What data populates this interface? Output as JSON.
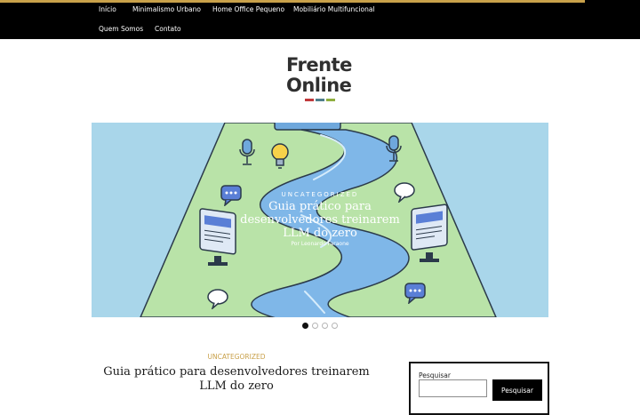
{
  "nav": {
    "items": [
      {
        "label": "Início"
      },
      {
        "label": "Minimalismo Urbano"
      },
      {
        "label": "Home Office Pequeno"
      },
      {
        "label": "Mobiliário Multifuncional"
      },
      {
        "label": "Quem Somos"
      },
      {
        "label": "Contato"
      }
    ]
  },
  "logo": {
    "line1": "Frente",
    "line2": "Online",
    "swatch_colors": [
      "#c0393b",
      "#4f7f8c",
      "#8fae3f"
    ]
  },
  "slider": {
    "category": "UNCATEGORIZED",
    "title": "Guia prático para desenvolvedores treinarem LLM do zero",
    "author": "Por Leonardo Faraone",
    "slide_count": 4,
    "active_index": 0
  },
  "post": {
    "category": "UNCATEGORIZED",
    "title": "Guia prático para desenvolvedores treinarem LLM do zero"
  },
  "search": {
    "label": "Pesquisar",
    "value": "",
    "button_label": "Pesquisar"
  },
  "colors": {
    "topbar": "#000000",
    "accent_gold": "#c9a14a",
    "logo_text": "#2f2f2f"
  },
  "icons": [
    "microphone-icon",
    "lightbulb-icon",
    "chat-bubble-icon",
    "monitor-icon"
  ]
}
